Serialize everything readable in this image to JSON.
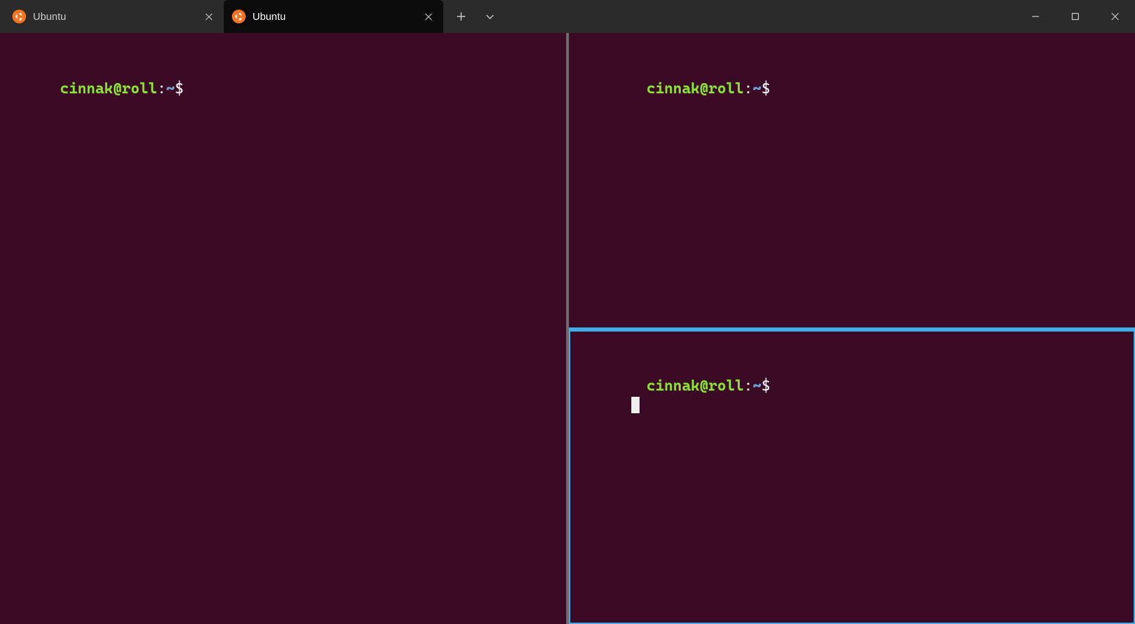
{
  "colors": {
    "pane_bg": "#3b0a24",
    "accent": "#3daee9",
    "splitter_idle": "#6f6a6d",
    "prompt_userhost": "#8ae234",
    "prompt_cwd": "#729fcf",
    "prompt_symbol": "#eeeeec"
  },
  "titlebar": {
    "tabs": [
      {
        "label": "Ubuntu",
        "icon": "ubuntu-logo-icon",
        "active": false
      },
      {
        "label": "Ubuntu",
        "icon": "ubuntu-logo-icon",
        "active": true
      }
    ],
    "new_tab_tooltip": "New tab",
    "dropdown_tooltip": "New tab dropdown",
    "window_controls": {
      "minimize": "Minimize",
      "maximize": "Maximize",
      "close": "Close"
    }
  },
  "panes": {
    "left": {
      "prompt": {
        "userhost": "cinnak@roll",
        "colon": ":",
        "cwd": "~",
        "symbol": "$"
      },
      "input": "",
      "focused": false
    },
    "right_top": {
      "prompt": {
        "userhost": "cinnak@roll",
        "colon": ":",
        "cwd": "~",
        "symbol": "$"
      },
      "input": "",
      "focused": false
    },
    "right_bottom": {
      "prompt": {
        "userhost": "cinnak@roll",
        "colon": ":",
        "cwd": "~",
        "symbol": "$"
      },
      "input": "",
      "focused": true
    }
  }
}
